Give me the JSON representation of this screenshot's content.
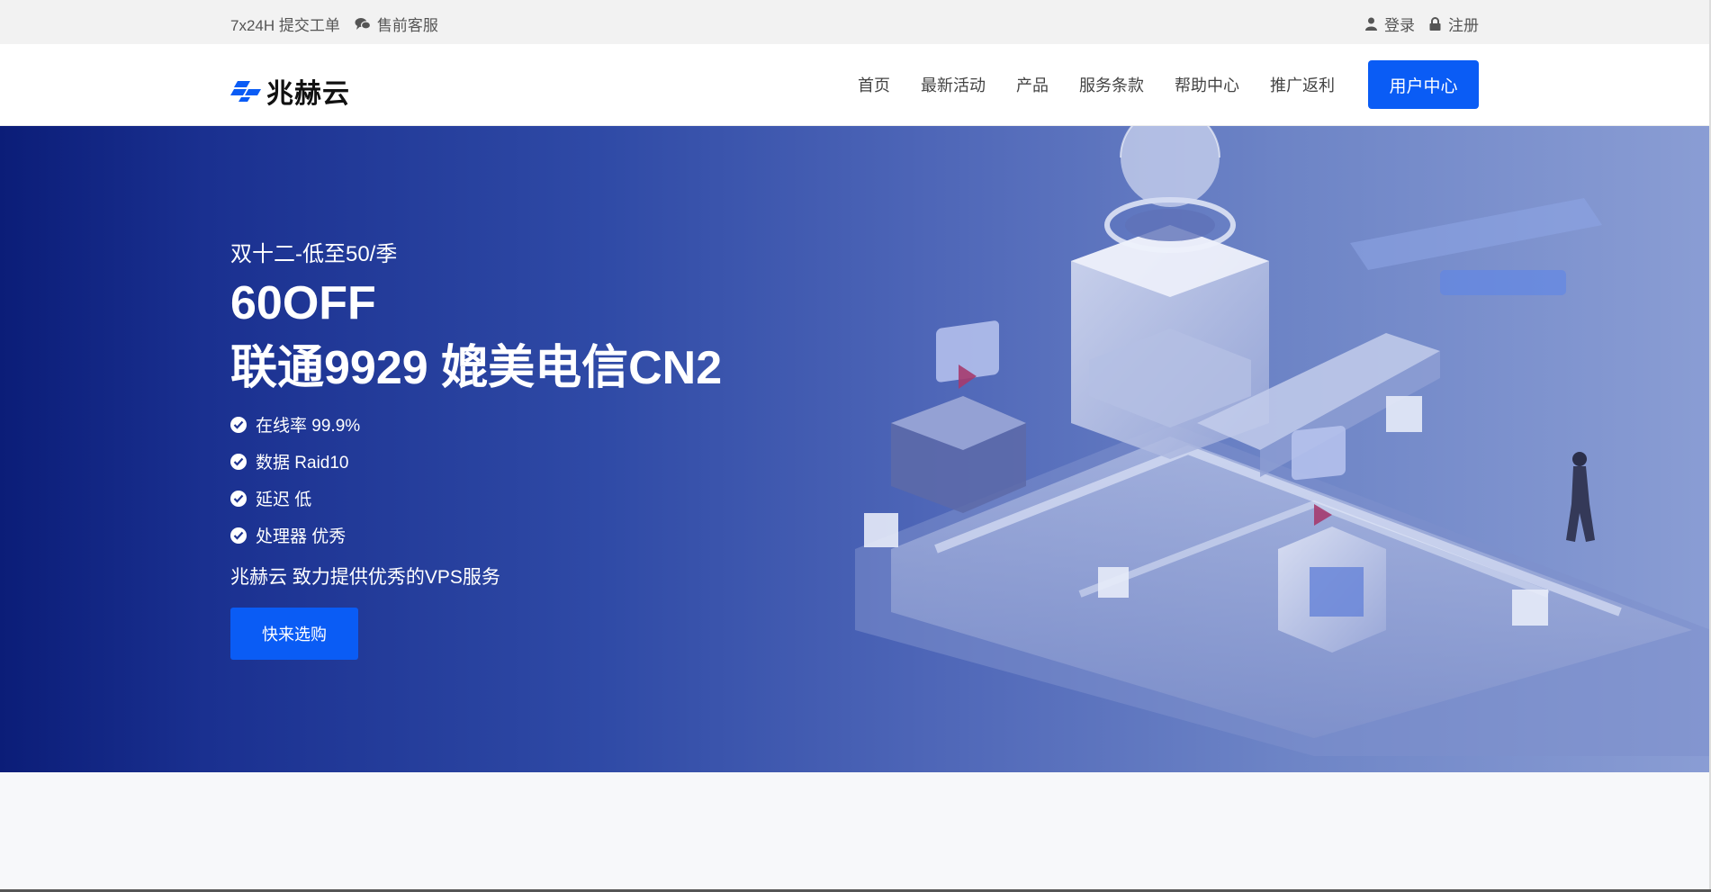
{
  "topbar": {
    "ticket": "7x24H 提交工单",
    "support": "售前客服",
    "login": "登录",
    "register": "注册"
  },
  "header": {
    "brand": "兆赫云",
    "nav": [
      "首页",
      "最新活动",
      "产品",
      "服务条款",
      "帮助中心",
      "推广返利"
    ],
    "user_center": "用户中心"
  },
  "hero": {
    "subtitle": "双十二-低至50/季",
    "headline1": "60OFF",
    "headline2": "联通9929 媲美电信CN2",
    "features": [
      "在线率 99.9%",
      "数据 Raid10",
      "延迟 低",
      "处理器 优秀"
    ],
    "tagline": "兆赫云 致力提供优秀的VPS服务",
    "cta": "快来选购"
  },
  "colors": {
    "accent": "#0a5cf5",
    "hero_dark": "#0b1d78",
    "hero_light": "#8a9dd4"
  },
  "icons": [
    "chat-icon",
    "user-icon",
    "lock-icon",
    "check-circle-icon",
    "logo-mark-icon"
  ]
}
